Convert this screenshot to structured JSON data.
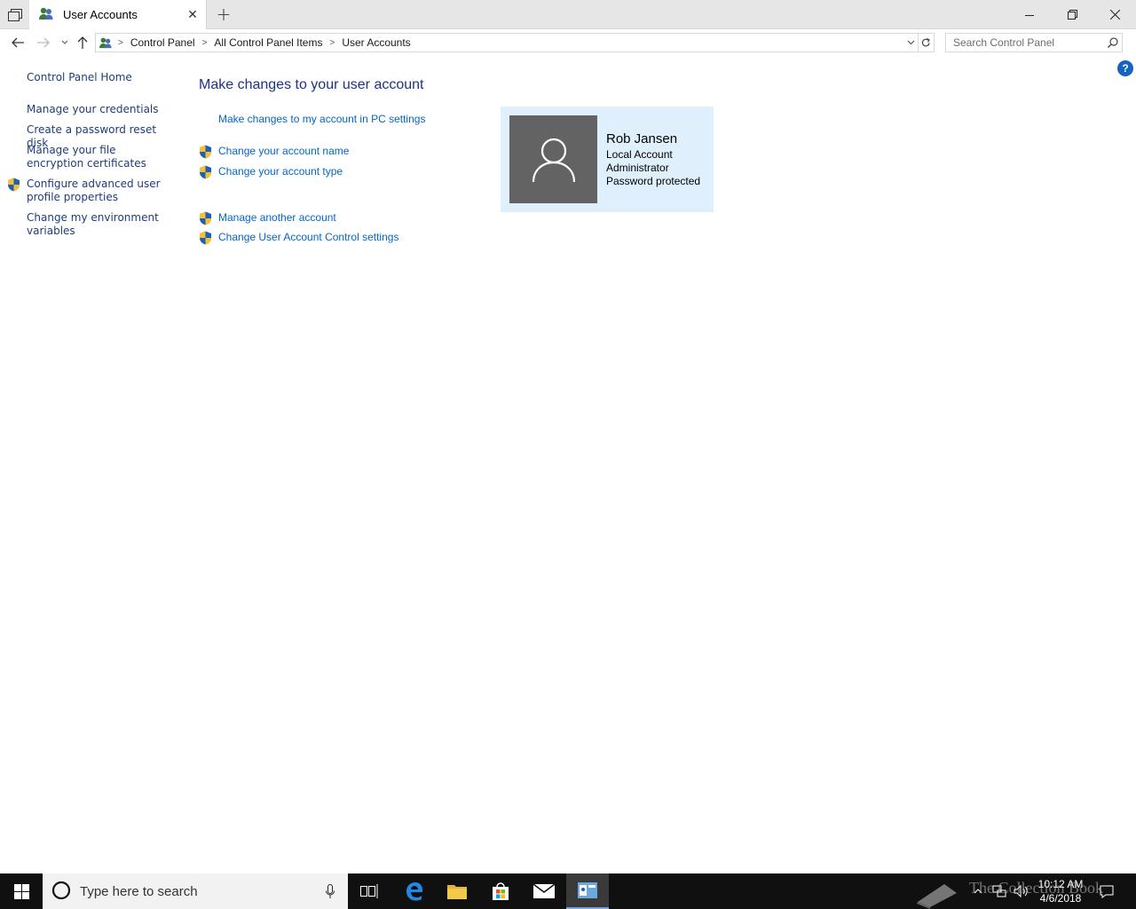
{
  "window": {
    "tab_title": "User Accounts",
    "controls": [
      "minimize",
      "restore",
      "close"
    ]
  },
  "address_bar": {
    "breadcrumbs": [
      "Control Panel",
      "All Control Panel Items",
      "User Accounts"
    ]
  },
  "search": {
    "placeholder": "Search Control Panel"
  },
  "sidebar": {
    "items": [
      {
        "label": "Control Panel Home",
        "shield": false
      },
      {
        "label": "Manage your credentials",
        "shield": false
      },
      {
        "label": "Create a password reset disk",
        "shield": false
      },
      {
        "label": "Manage your file encryption certificates",
        "shield": false
      },
      {
        "label": "Configure advanced user profile properties",
        "shield": true
      },
      {
        "label": "Change my environment variables",
        "shield": false
      }
    ]
  },
  "main": {
    "title": "Make changes to your user account",
    "tasks": [
      {
        "label": "Make changes to my account in PC settings",
        "shield": false
      },
      {
        "label": "Change your account name",
        "shield": true
      },
      {
        "label": "Change your account type",
        "shield": true
      },
      {
        "label": "Manage another account",
        "shield": true
      },
      {
        "label": "Change User Account Control settings",
        "shield": true
      }
    ]
  },
  "account": {
    "name": "Rob Jansen",
    "details": [
      "Local Account",
      "Administrator",
      "Password protected"
    ]
  },
  "taskbar": {
    "search_placeholder": "Type here to search",
    "apps": [
      "task-view",
      "edge",
      "file-explorer",
      "store",
      "mail",
      "control-panel"
    ],
    "active_app": "control-panel",
    "time": "10:12 AM",
    "date": "4/6/2018"
  },
  "watermark": "The Collection Book",
  "colors": {
    "link": "#0066cc",
    "sidebar_link": "#1e3d7b",
    "title": "#1e3287",
    "card_bg": "#dff0fc",
    "avatar_bg": "#636363",
    "taskbar_bg": "#101010"
  }
}
